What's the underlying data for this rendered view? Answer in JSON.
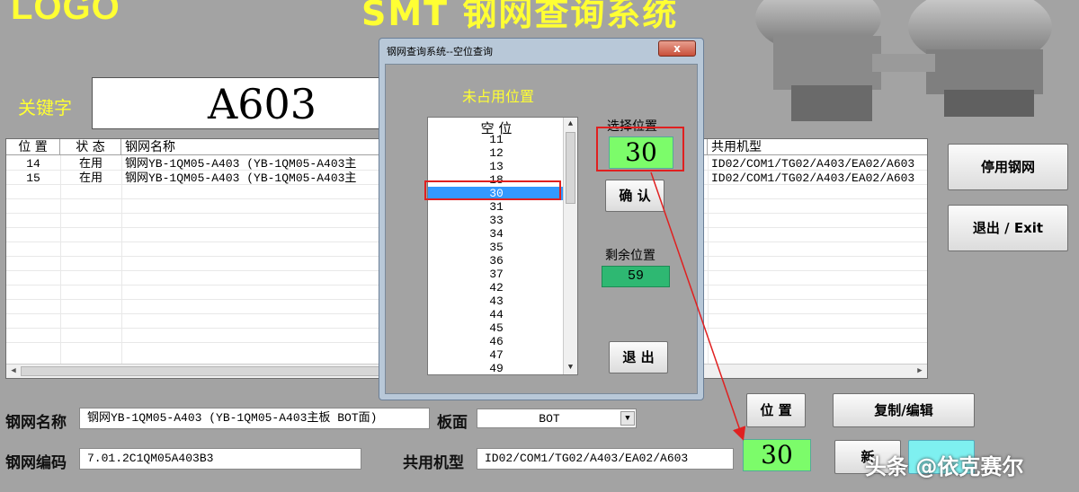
{
  "header": {
    "logo": "LOGO",
    "title": "SMT 钢网查询系统"
  },
  "search": {
    "label": "关键字",
    "value": "A603"
  },
  "listview": {
    "columns": [
      "位 置",
      "状 态",
      "钢网名称",
      "共用机型"
    ],
    "rows": [
      {
        "pos": "14",
        "status": "在用",
        "name": "钢网YB-1QM05-A403 (YB-1QM05-A403主",
        "models": "ID02/COM1/TG02/A403/EA02/A603"
      },
      {
        "pos": "15",
        "status": "在用",
        "name": "钢网YB-1QM05-A403 (YB-1QM05-A403主",
        "models": "ID02/COM1/TG02/A403/EA02/A603"
      }
    ]
  },
  "side_buttons": {
    "disable": "停用钢网",
    "exit": "退出 / Exit"
  },
  "form": {
    "name_label": "钢网名称",
    "name_value": "钢网YB-1QM05-A403 (YB-1QM05-A403主板 BOT面)",
    "side_label": "板面",
    "side_value": "BOT",
    "code_label": "钢网编码",
    "code_value": "7.01.2C1QM05A403B3",
    "shared_label": "共用机型",
    "shared_value": "ID02/COM1/TG02/A403/EA02/A603",
    "position_button": "位 置",
    "copy_edit_button": "复制/编辑",
    "position_value": "30",
    "new_button": "新"
  },
  "dialog": {
    "title": "钢网查询系统--空位查询",
    "close": "x",
    "heading": "未占用位置",
    "list_header": "空 位",
    "list_items": [
      "11",
      "12",
      "13",
      "18",
      "30",
      "31",
      "33",
      "34",
      "35",
      "36",
      "37",
      "42",
      "43",
      "44",
      "45",
      "46",
      "47",
      "49"
    ],
    "selected_item": "30",
    "select_label": "选择位置",
    "select_value": "30",
    "confirm_button": "确 认",
    "remaining_label": "剩余位置",
    "remaining_value": "59",
    "exit_button": "退 出"
  },
  "watermark": "头条 @依克赛尔",
  "colors": {
    "accent_yellow": "#ffff33",
    "highlight_green": "#7cfc6a",
    "remaining_green": "#2eb872",
    "selection_blue": "#3399ff",
    "annotation_red": "#e02020"
  }
}
